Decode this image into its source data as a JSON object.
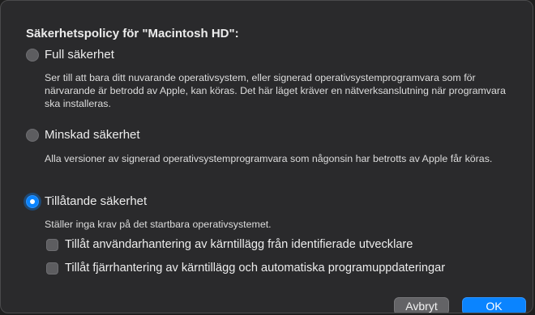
{
  "dialog": {
    "title": "Säkerhetspolicy för \"Macintosh HD\":",
    "options": [
      {
        "label": "Full säkerhet",
        "selected": false,
        "description": "Ser till att bara ditt nuvarande operativsystem, eller signerad operativsystemprogramvara som för närvarande är betrodd av Apple, kan köras. Det här läget kräver en nätverksanslutning när programvara ska installeras."
      },
      {
        "label": "Minskad säkerhet",
        "selected": false,
        "description": "Alla versioner av signerad operativsystemprogramvara som någonsin har betrotts av Apple får köras."
      },
      {
        "label": "Tillåtande säkerhet",
        "selected": true,
        "description": "Ställer inga krav på det startbara operativsystemet."
      }
    ],
    "checkboxes": [
      {
        "label": "Tillåt användarhantering av kärntillägg från identifierade utvecklare",
        "checked": false
      },
      {
        "label": "Tillåt fjärrhantering av kärntillägg och automatiska programuppdateringar",
        "checked": false
      }
    ],
    "buttons": {
      "cancel": "Avbryt",
      "ok": "OK"
    }
  },
  "colors": {
    "background": "#2a2a2c",
    "accent": "#0a84ff",
    "control": "#5d5d60"
  }
}
